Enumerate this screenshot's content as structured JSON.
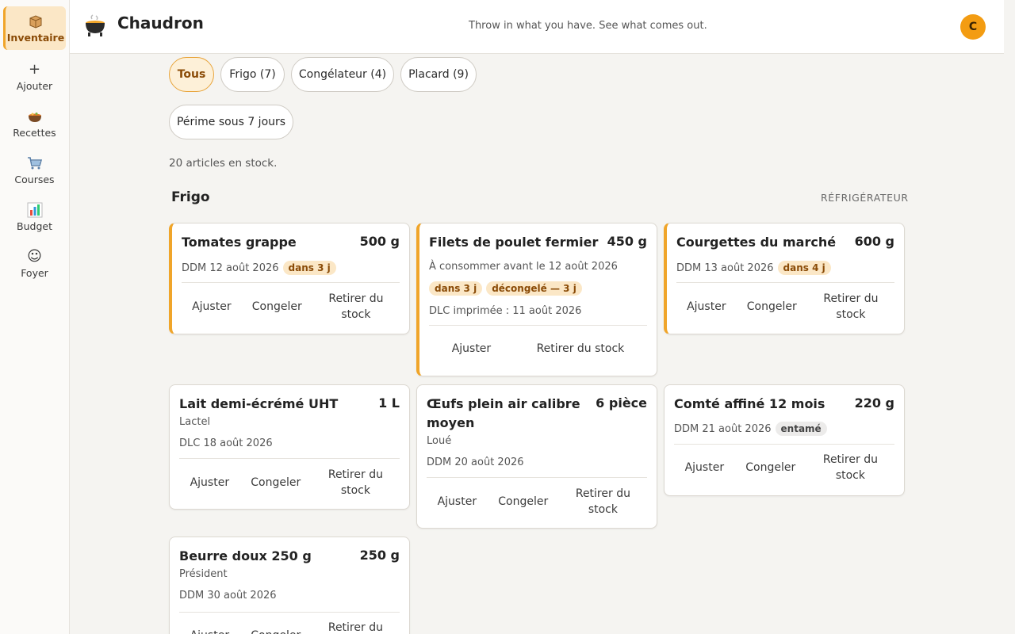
{
  "sidebar": {
    "items": [
      {
        "label": "Inventaire",
        "icon": "box-icon",
        "glyph": "📦"
      },
      {
        "label": "Ajouter",
        "icon": "plus-icon",
        "glyph": "+"
      },
      {
        "label": "Recettes",
        "icon": "pot-icon",
        "glyph": "🍲"
      },
      {
        "label": "Courses",
        "icon": "cart-icon",
        "glyph": "🛒"
      },
      {
        "label": "Budget",
        "icon": "chart-icon",
        "glyph": "📊"
      },
      {
        "label": "Foyer",
        "icon": "smiley-icon",
        "glyph": "☺"
      }
    ]
  },
  "header": {
    "title": "Chaudron",
    "tagline": "Throw in what you have. See what comes out.",
    "avatar_letter": "C"
  },
  "filters": [
    "Tous",
    "Frigo (7)",
    "Congélateur (4)",
    "Placard (9)",
    "Périme sous 7 jours"
  ],
  "stock_count": "20 articles en stock.",
  "section": {
    "title": "Frigo",
    "subtitle": "RÉFRIGÉRATEUR"
  },
  "actions": {
    "adjust": "Ajuster",
    "freeze": "Congeler",
    "remove": "Retirer du stock"
  },
  "cards": [
    {
      "name": "Tomates grappe",
      "qty": "500 g",
      "date": "DDM 12 août 2026",
      "badges": [
        "dans 3 j"
      ]
    },
    {
      "name": "Filets de poulet fermier",
      "qty": "450 g",
      "date": "À consommer avant le 12 août 2026",
      "badges": [
        "dans 3 j",
        "décongelé — 3 j"
      ],
      "note": "DLC imprimée : 11 août 2026"
    },
    {
      "name": "Courgettes du marché",
      "qty": "600 g",
      "date": "DDM 13 août 2026",
      "badges": [
        "dans 4 j"
      ]
    },
    {
      "name": "Lait demi-écrémé UHT",
      "qty": "1 L",
      "brand": "Lactel",
      "date": "DLC 18 août 2026"
    },
    {
      "name": "Œufs plein air calibre moyen",
      "qty": "6 pièce",
      "brand": "Loué",
      "date": "DDM 20 août 2026"
    },
    {
      "name": "Comté affiné 12 mois",
      "qty": "220 g",
      "date": "DDM 21 août 2026",
      "badges": [
        "entamé"
      ]
    },
    {
      "name": "Beurre doux 250 g",
      "qty": "250 g",
      "brand": "Président",
      "date": "DDM 30 août 2026"
    }
  ],
  "colors": {
    "accent": "#f0a52a",
    "accent_bg": "#fbe7c6",
    "accent_text": "#8a4b07",
    "avatar": "#f39c12"
  }
}
